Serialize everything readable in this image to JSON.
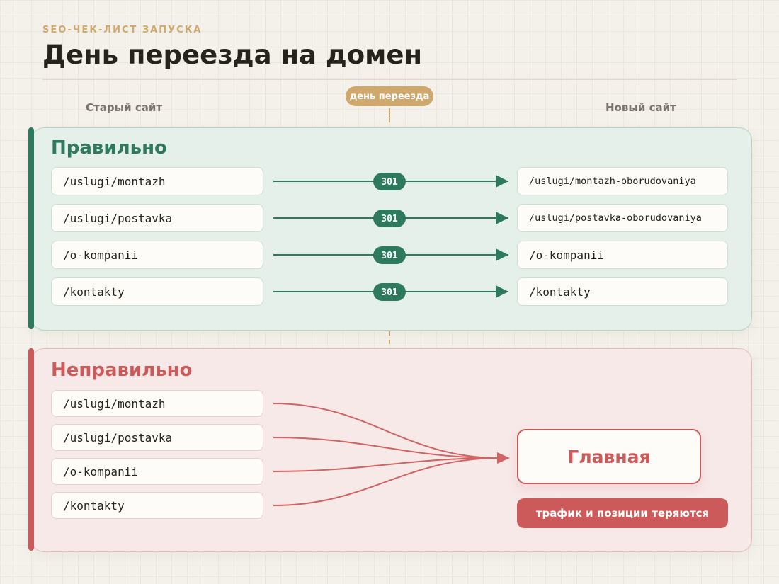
{
  "header": {
    "kicker": "SEO-ЧЕК-ЛИСТ ЗАПУСКА",
    "title": "День переезда на домен"
  },
  "columns": {
    "old_site": "Старый сайт",
    "migration_day": "день переезда",
    "new_site": "Новый сайт"
  },
  "correct": {
    "heading": "Правильно",
    "redirects": [
      {
        "from": "/uslugi/montazh",
        "code": "301",
        "to": "/uslugi/montazh-oborudovaniya"
      },
      {
        "from": "/uslugi/postavka",
        "code": "301",
        "to": "/uslugi/postavka-oborudovaniya"
      },
      {
        "from": "/o-kompanii",
        "code": "301",
        "to": "/o-kompanii"
      },
      {
        "from": "/kontakty",
        "code": "301",
        "to": "/kontakty"
      }
    ]
  },
  "incorrect": {
    "heading": "Неправильно",
    "sources": [
      "/uslugi/montazh",
      "/uslugi/postavka",
      "/o-kompanii",
      "/kontakty"
    ],
    "target": "Главная",
    "warning": "трафик и позиции теряются"
  },
  "colors": {
    "background": "#f4f1ea",
    "accent_gold": "#cfa86e",
    "correct_green": "#2e7a5e",
    "correct_panel": "#e6f0ea",
    "incorrect_red": "#cc5a5a",
    "incorrect_panel": "#f7e9e8"
  }
}
